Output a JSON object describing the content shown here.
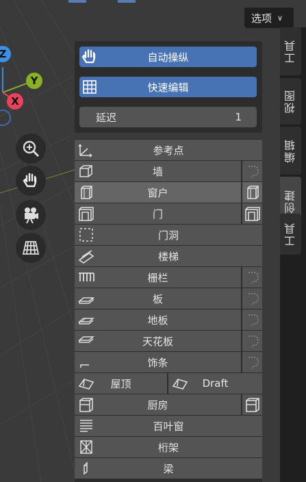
{
  "header": {
    "options_label": "选项"
  },
  "axes": {
    "x": "X",
    "y": "Y",
    "z": "Z"
  },
  "top_panel": {
    "auto_manipulate": "自动操纵",
    "quick_edit": "快速编辑",
    "delay_label": "延迟",
    "delay_value": "1"
  },
  "tools": [
    {
      "label": "参考点",
      "icon": "snap-point-icon"
    },
    {
      "label": "墙",
      "icon": "wall-icon"
    },
    {
      "label": "窗户",
      "icon": "window-icon"
    },
    {
      "label": "门",
      "icon": "door-icon"
    },
    {
      "label": "门洞",
      "icon": "opening-icon"
    },
    {
      "label": "楼梯",
      "icon": "stair-icon"
    },
    {
      "label": "栅栏",
      "icon": "fence-icon"
    },
    {
      "label": "板",
      "icon": "slab-icon"
    },
    {
      "label": "地板",
      "icon": "floor-icon"
    },
    {
      "label": "天花板",
      "icon": "ceiling-icon"
    },
    {
      "label": "饰条",
      "icon": "molding-icon"
    },
    {
      "label": "屋顶",
      "label2": "Draft",
      "icon": "roof-icon"
    },
    {
      "label": "厨房",
      "icon": "kitchen-icon"
    },
    {
      "label": "百叶窗",
      "icon": "blind-icon"
    },
    {
      "label": "桁架",
      "icon": "truss-icon"
    },
    {
      "label": "梁",
      "icon": "beam-icon"
    }
  ],
  "tabs": [
    "工具",
    "视图",
    "编辑",
    "创建",
    "工具"
  ],
  "colors": {
    "accent": "#4772b3",
    "x_axis": "#e8435a",
    "y_axis": "#8ab024",
    "z_axis": "#3d8ee6"
  }
}
